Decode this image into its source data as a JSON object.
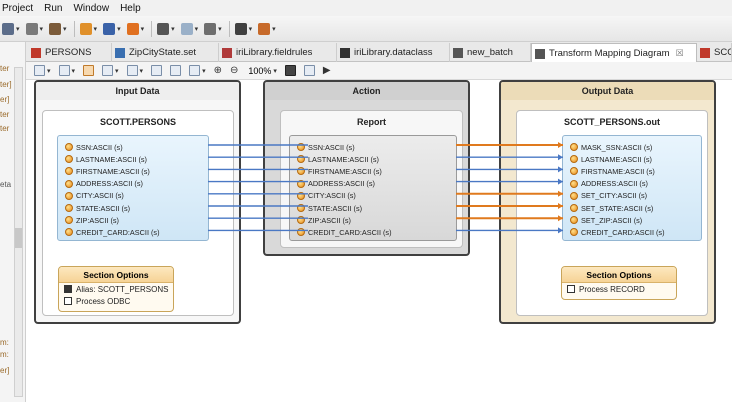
{
  "menubar": {
    "items": [
      "Project",
      "Run",
      "Window",
      "Help"
    ]
  },
  "toolbar": {
    "buttons": [
      {
        "name": "run-dropdown",
        "color": "#5c6d8a"
      },
      {
        "name": "debug-dropdown",
        "color": "#7a7a7a"
      },
      {
        "name": "package-dropdown",
        "color": "#7b5b3a"
      },
      {
        "name": "external-tools-dropdown",
        "color": "#e0902a"
      },
      {
        "name": "wizard-dropdown",
        "color": "#3a62a8"
      },
      {
        "name": "perspective-dropdown",
        "color": "#e07020"
      },
      {
        "name": "cursor-dropdown",
        "color": "#555555"
      },
      {
        "name": "link-dropdown",
        "color": "#9ab0c8"
      },
      {
        "name": "gear-dropdown",
        "color": "#6e6e6e"
      },
      {
        "name": "status-dropdown",
        "color": "#404040"
      },
      {
        "name": "search-dropdown",
        "color": "#c76a2a"
      }
    ]
  },
  "leftpanel": {
    "labels": [
      "ter",
      "ter]",
      "er]",
      "ter",
      "ter",
      "eta",
      "m:",
      "m:",
      "er]"
    ]
  },
  "tabs": [
    {
      "label": "PERSONS",
      "icon_color": "#c0392b"
    },
    {
      "label": "ZipCityState.set",
      "icon_color": "#3a6fb0"
    },
    {
      "label": "iriLibrary.fieldrules",
      "icon_color": "#b03a3a"
    },
    {
      "label": "iriLibrary.dataclass",
      "icon_color": "#333333"
    },
    {
      "label": "new_batch",
      "icon_color": "#555555"
    },
    {
      "label": "Transform Mapping Diagram",
      "close": "☒",
      "icon_color": "#555555"
    },
    {
      "label": "SCOT",
      "icon_color": "#c0392b"
    }
  ],
  "editor_toolbar": {
    "zoom": "100%"
  },
  "diagram": {
    "input": {
      "frame_title": "Input Data",
      "card_title": "SCOTT.PERSONS",
      "fields": [
        "SSN:ASCII (s)",
        "LASTNAME:ASCII (s)",
        "FIRSTNAME:ASCII (s)",
        "ADDRESS:ASCII (s)",
        "CITY:ASCII (s)",
        "STATE:ASCII (s)",
        "ZIP:ASCII (s)",
        "CREDIT_CARD:ASCII (s)"
      ],
      "options_title": "Section Options",
      "options": [
        "Alias: SCOTT_PERSONS",
        "Process ODBC"
      ]
    },
    "action": {
      "frame_title": "Action",
      "card_title": "Report",
      "fields": [
        "SSN:ASCII (s)",
        "LASTNAME:ASCII (s)",
        "FIRSTNAME:ASCII (s)",
        "ADDRESS:ASCII (s)",
        "CITY:ASCII (s)",
        "STATE:ASCII (s)",
        "ZIP:ASCII (s)",
        "CREDIT_CARD:ASCII (s)"
      ]
    },
    "output": {
      "frame_title": "Output Data",
      "card_title": "SCOTT_PERSONS.out",
      "fields": [
        "MASK_SSN:ASCII (s)",
        "LASTNAME:ASCII (s)",
        "FIRSTNAME:ASCII (s)",
        "ADDRESS:ASCII (s)",
        "SET_CITY:ASCII (s)",
        "SET_STATE:ASCII (s)",
        "SET_ZIP:ASCII (s)",
        "CREDIT_CARD:ASCII (s)"
      ],
      "options_title": "Section Options",
      "options": [
        "Process RECORD"
      ]
    },
    "links_right": [
      "orange",
      "blue",
      "blue",
      "blue",
      "orange",
      "orange",
      "orange",
      "blue"
    ],
    "colors": {
      "blue_link": "#4a78c4",
      "orange_link": "#e07a1e",
      "action_frame_bg": "#d9d9d9",
      "output_frame_bg": "#f3e8cf"
    }
  }
}
